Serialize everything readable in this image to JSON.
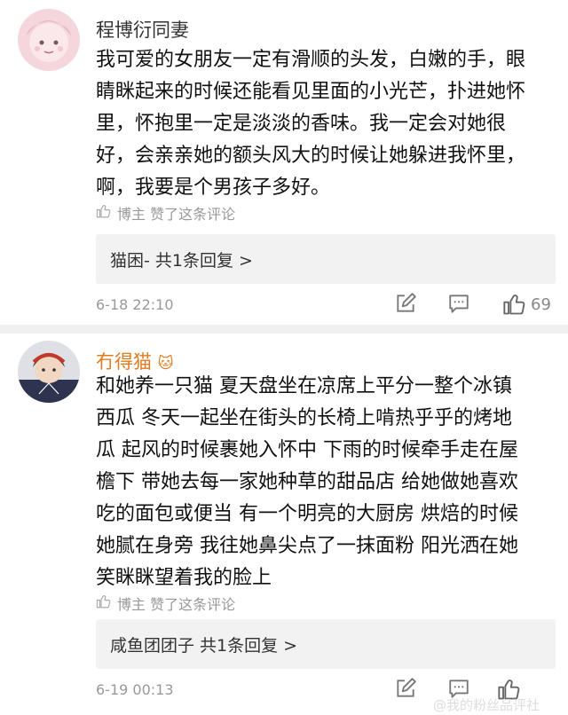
{
  "comments": [
    {
      "username": "程博衍同妻",
      "username_color": "#333333",
      "text_lines": [
        "我可爱的女朋友一定有滑顺的头发，白嫩的手，眼",
        "睛眯起来的时候还能看见里面的小光芒，扑进她怀",
        "里，怀抱里一定是淡淡的香味。我一定会对她很",
        "好，会亲亲她的额头风大的时候让她躲进我怀里，",
        "啊，我要是个男孩子多好。"
      ],
      "author_liked": "博主  赞了这条评论",
      "reply_summary": "猫困-  共1条回复 >",
      "timestamp": "6-18 22:10",
      "like_count": "69"
    },
    {
      "username": "冇得猫",
      "username_color": "#e07b1f",
      "badge": "🐱",
      "text_lines": [
        "和她养一只猫 夏天盘坐在凉席上平分一整个冰镇",
        "西瓜 冬天一起坐在街头的长椅上啃热乎乎的烤地",
        "瓜 起风的时候裹她入怀中 下雨的时候牵手走在屋",
        "檐下 带她去每一家她种草的甜品店 给她做她喜欢",
        "吃的面包或便当 有一个明亮的大厨房 烘焙的时候",
        "她腻在身旁 我往她鼻尖点了一抹面粉 阳光洒在她",
        "笑眯眯望着我的脸上"
      ],
      "author_liked": "博主  赞了这条评论",
      "reply_summary": "咸鱼团团子  共1条回复 >",
      "timestamp": "6-19 00:13"
    }
  ],
  "watermark": "@我的粉丝品评社"
}
